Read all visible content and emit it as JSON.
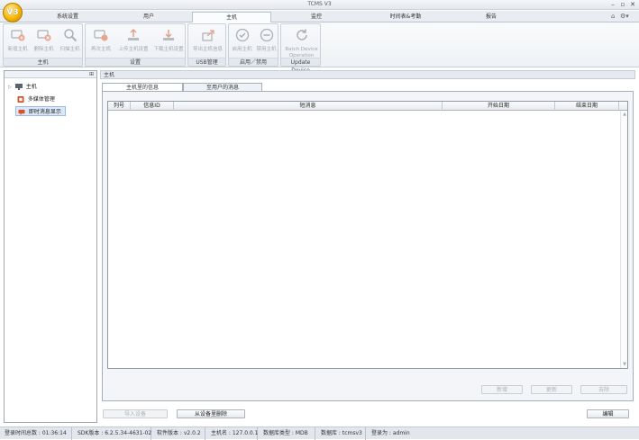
{
  "window": {
    "title": "TCMS V3"
  },
  "logo": {
    "text": "V3"
  },
  "tabs": [
    {
      "label": "系统设置"
    },
    {
      "label": "用户"
    },
    {
      "label": "主机",
      "active": true
    },
    {
      "label": "监控"
    },
    {
      "label": "时间表&考勤"
    },
    {
      "label": "报告"
    }
  ],
  "ribbon": {
    "groups": [
      {
        "label": "主机",
        "buttons": [
          {
            "label": "新增主机",
            "icon": "add-device-icon"
          },
          {
            "label": "删除主机",
            "icon": "delete-device-icon"
          },
          {
            "label": "扫描主机",
            "icon": "search-icon"
          }
        ]
      },
      {
        "label": "设置",
        "buttons": [
          {
            "label": "再次主机",
            "icon": "device-icon"
          },
          {
            "label": "上传主机设置",
            "icon": "upload-icon"
          },
          {
            "label": "下载主机设置",
            "icon": "download-icon"
          }
        ]
      },
      {
        "label": "USB管理",
        "buttons": [
          {
            "label": "导出主机信息",
            "icon": "export-icon"
          }
        ]
      },
      {
        "label": "启用／禁用",
        "buttons": [
          {
            "label": "启用主机",
            "icon": "check-circle-icon"
          },
          {
            "label": "禁用主机",
            "icon": "minus-circle-icon"
          }
        ]
      },
      {
        "label": "Update Device",
        "buttons": [
          {
            "label": "Batch Device Operation",
            "icon": "refresh-icon"
          }
        ]
      }
    ]
  },
  "sidebar": {
    "items": [
      {
        "label": "主机",
        "icon": "computer-icon"
      },
      {
        "label": "多媒体管理",
        "icon": "media-icon"
      },
      {
        "label": "即时消息显示",
        "icon": "message-icon",
        "selected": true
      }
    ]
  },
  "main": {
    "header": "主机",
    "subtabs": [
      {
        "label": "主机里的信息",
        "active": true
      },
      {
        "label": "至用户的消息"
      }
    ],
    "table": {
      "columns": [
        "列号",
        "信息ID",
        "短消息",
        "开始日期",
        "结束日期"
      ],
      "rows": []
    },
    "grid_buttons": {
      "add": "新增",
      "update": "更新",
      "delete": "去除"
    },
    "footer_buttons": {
      "import": "导入设备",
      "remove_from_device": "从设备里删除",
      "edit": "编辑"
    }
  },
  "status": {
    "items": [
      "登录时间总数 : 01:36:14",
      "SDK版本 : 6.2.5.34-4631-02",
      "软件版本 : v2.0.2",
      "主机名 : 127.0.0.1",
      "数据库类型 : MDB",
      "数据库 : tcmsv3",
      "登录为 : admin"
    ]
  }
}
